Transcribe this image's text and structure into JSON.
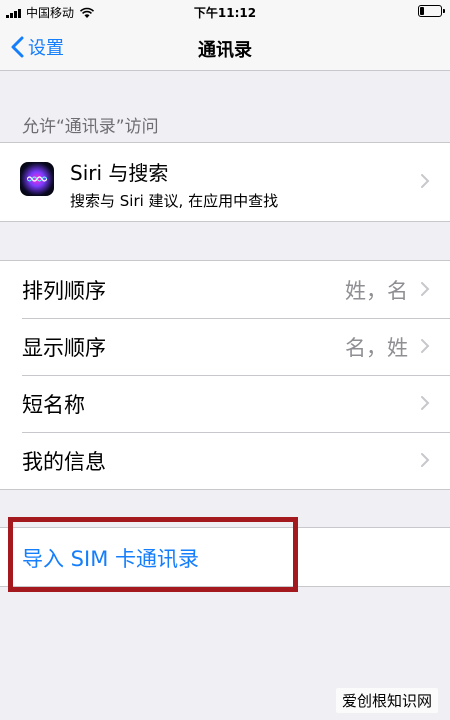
{
  "status_bar": {
    "carrier": "中国移动",
    "time": "下午11:12"
  },
  "nav": {
    "back_label": "设置",
    "title": "通讯录"
  },
  "sections": {
    "access_header": "允许“通讯录”访问",
    "siri": {
      "title": "Siri 与搜索",
      "subtitle": "搜索与 Siri 建议, 在应用中查找"
    },
    "settings_rows": [
      {
        "label": "排列顺序",
        "value": "姓，名"
      },
      {
        "label": "显示顺序",
        "value": "名，姓"
      },
      {
        "label": "短名称",
        "value": ""
      },
      {
        "label": "我的信息",
        "value": ""
      }
    ],
    "import": {
      "label": "导入 SIM 卡通讯录"
    }
  },
  "watermark": "爱创根知识网",
  "colors": {
    "accent": "#157efb",
    "highlight": "#a3191d",
    "background": "#efeff4"
  }
}
